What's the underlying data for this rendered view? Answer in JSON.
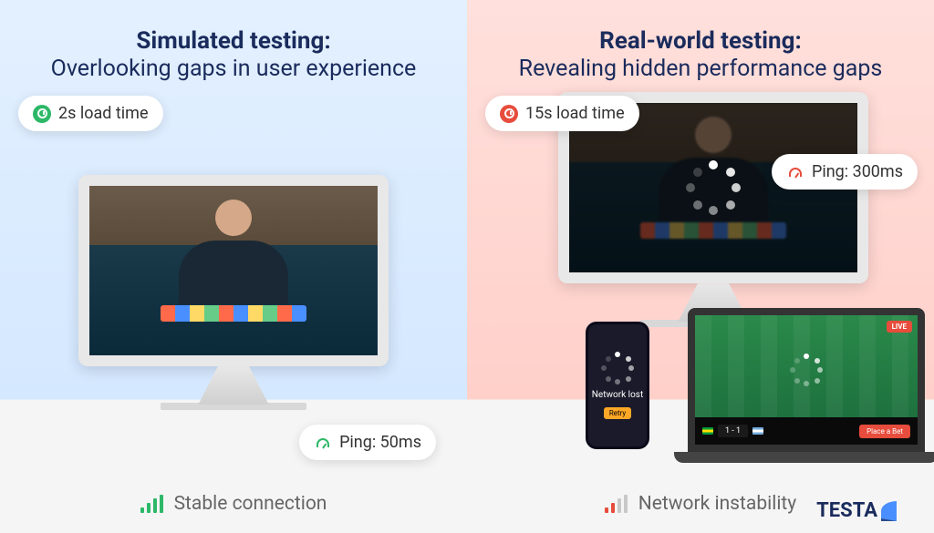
{
  "left": {
    "title": "Simulated testing:",
    "subtitle": "Overlooking gaps in user experience",
    "load_time": "2s load time",
    "ping": "Ping: 50ms",
    "footer": "Stable connection"
  },
  "right": {
    "title": "Real-world testing:",
    "subtitle": "Revealing hidden performance gaps",
    "load_time": "15s load time",
    "ping": "Ping: 300ms",
    "footer": "Network instability",
    "phone_msg": "Network lost",
    "phone_btn": "Retry",
    "live": "LIVE",
    "score": "1 - 1",
    "bet": "Place a Bet"
  },
  "logo": "TESTA"
}
